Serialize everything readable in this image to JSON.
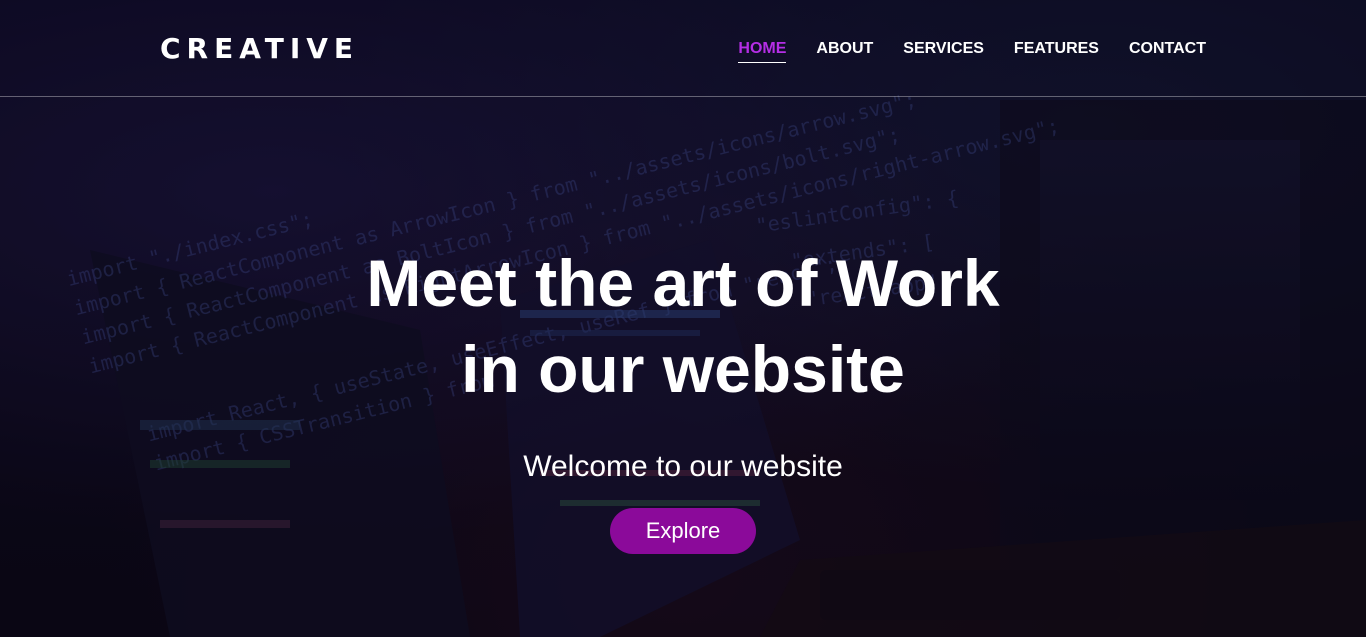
{
  "brand": {
    "name": "CREATIVE"
  },
  "nav": {
    "items": [
      {
        "label": "HOME",
        "active": true
      },
      {
        "label": "ABOUT",
        "active": false
      },
      {
        "label": "SERVICES",
        "active": false
      },
      {
        "label": "FEATURES",
        "active": false
      },
      {
        "label": "CONTACT",
        "active": false
      }
    ]
  },
  "hero": {
    "headline_line1": "Meet the art of Work",
    "headline_line2": "in our website",
    "subtitle": "Welcome to our website",
    "cta_label": "Explore"
  },
  "background": {
    "code_lines": [
      "import \"./index.css\";",
      "import { ReactComponent as ArrowIcon } from \"../assets/icons/arrow.svg\";",
      "import { ReactComponent as BoltIcon } from \"../assets/icons/bolt.svg\";",
      "import { ReactComponent as RightArrowIcon } from \"../assets/icons/right-arrow.svg\";",
      "import React, { useState, useEffect, useRef } from \"react\";",
      "import { CSSTransition } from"
    ],
    "side_code_lines": [
      "\"eslintConfig\": {",
      "\"extends\": [",
      "\"react-app\""
    ]
  },
  "colors": {
    "accent": "#b52ee6",
    "button": "#8b0a9a",
    "text": "#ffffff"
  }
}
